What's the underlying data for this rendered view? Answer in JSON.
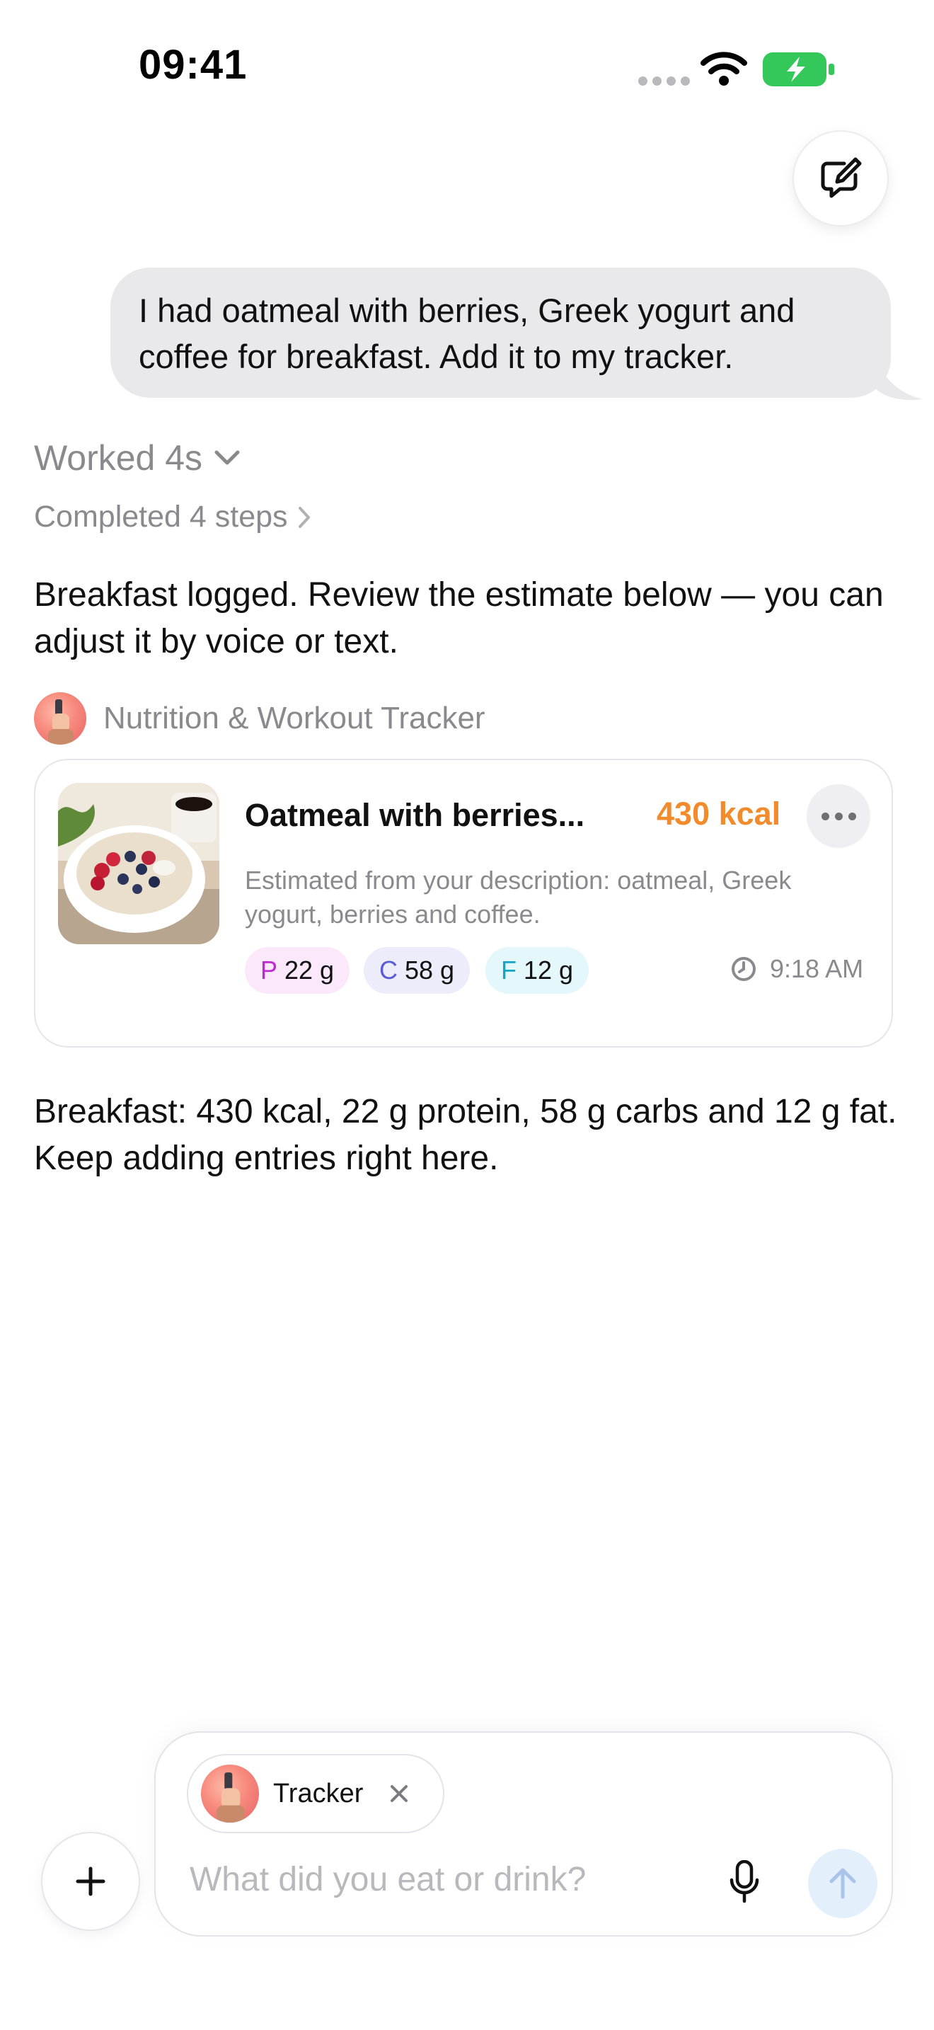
{
  "status_bar": {
    "time": "09:41"
  },
  "chat": {
    "user_message": "I had oatmeal with berries, Greek yogurt and coffee for breakfast. Add it to my tracker.",
    "worked_label": "Worked 4s",
    "completed_label": "Completed 4 steps",
    "assistant_intro": "Breakfast logged. Review the estimate below — you can adjust it by voice or text.",
    "app_name": "Nutrition & Workout Tracker",
    "summary": "Breakfast: 430 kcal, 22 g protein, 58 g carbs and 12 g fat. Keep adding entries right here."
  },
  "card": {
    "title": "Oatmeal with berries...",
    "kcal": "430 kcal",
    "description": "Estimated from your description: oatmeal, Greek yogurt, berries and coffee.",
    "macros": [
      {
        "key": "P",
        "value": "22 g"
      },
      {
        "key": "C",
        "value": "58 g"
      },
      {
        "key": "F",
        "value": "12 g"
      }
    ],
    "time": "9:18 AM"
  },
  "composer": {
    "tool_chip_label": "Tracker",
    "placeholder": "What did you eat or drink?"
  },
  "colors": {
    "kcal_accent": "#f28b2b",
    "battery_green": "#34c759",
    "send_button_bg": "#e4effc"
  }
}
